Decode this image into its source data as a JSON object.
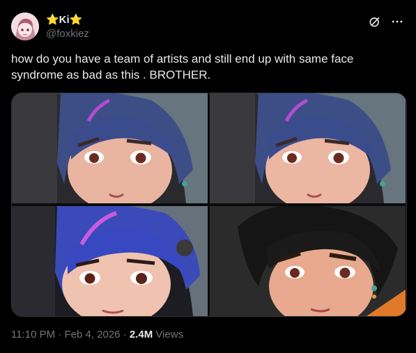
{
  "author": {
    "display_name": "⭐Ki⭐",
    "handle": "@foxkiez"
  },
  "tweet": {
    "text": "how do you have a team of artists and still end up with same face syndrome as bad as this . BROTHER.",
    "time": "11:10 PM",
    "separator1": " · ",
    "date": "Feb 4, 2026",
    "separator2": " · ",
    "views_count": "2.4M",
    "views_label": " Views"
  },
  "icons": {
    "grok": "grok-icon",
    "more": "more-icon"
  },
  "media": {
    "count": 4,
    "descriptions": [
      "character-face-blue-hair-headscarf",
      "character-face-blue-hair-headscarf",
      "character-face-vivid-blue-hair",
      "character-face-black-hair"
    ]
  },
  "colors": {
    "background": "#000000",
    "text": "#e7e9ea",
    "muted": "#71767b",
    "border": "#2f3336"
  }
}
